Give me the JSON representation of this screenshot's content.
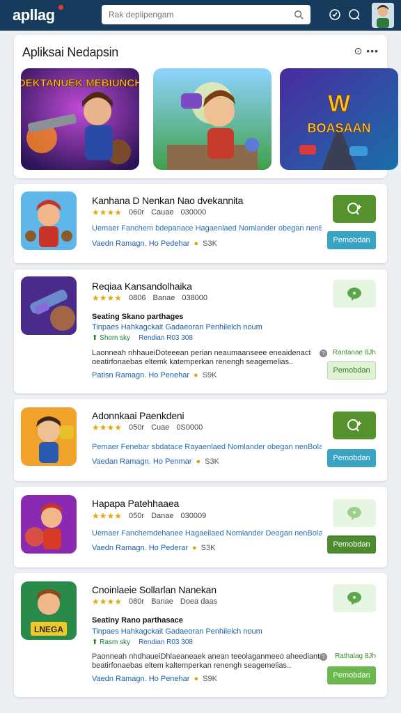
{
  "header": {
    "logo": "apllag",
    "search_placeholder": "Rak deplipengam"
  },
  "featured": {
    "title": "Apliksai Nedapsin",
    "more": "⊙ •••",
    "items": [
      {
        "label": "DEKTANUEK MEBIUNCH"
      },
      {
        "label": ""
      },
      {
        "label": "BOASAAN"
      }
    ]
  },
  "apps": [
    {
      "title": "Kanhana D Nenkan Nao dvekannita",
      "stars": "★★★★",
      "meta1": "060r",
      "meta2": "Cauae",
      "meta3": "030000",
      "desc": "Uemaer Fanchem bdepanace Hagaenlaed Nomlander obegan nenBelaet",
      "foot_left": "Vaedn Ramagn. Ho Pedehar",
      "foot_size": "S3K",
      "action": "Pemobdan"
    },
    {
      "title": "Reqiaa Kansandolhaika",
      "stars": "★★★★",
      "meta1": "0806",
      "meta2": "Banae",
      "meta3": "038000",
      "sub_title": "Seating Skano parthages",
      "sub_desc": "Tinpaes Hahkagckait Gadaeoran Penhilelch noum",
      "tag1": "⬆ Shom sky",
      "tag2": "Rendian R03 308",
      "desc2a": "Laonneah nhhaueiDoteeean perian neaumaanseee eneaidenact",
      "desc2b": "oeatirfonaebas eltemk katemperkan renengh seagemelias..",
      "side_note": "Rantanae 8Jh",
      "foot_left": "Patisn Ramagn. Ho Penehar",
      "foot_size": "S9K",
      "action": "Pemobdan"
    },
    {
      "title": "Adonnkaai Paenkdeni",
      "stars": "★★★★",
      "meta1": "050r",
      "meta2": "Cuae",
      "meta3": "0S0000",
      "desc": "Pemaer Fenebar sbdatace Rayaenlaed Nomlander obegan nenBolaet",
      "foot_left": "Vaedan Ramagn. Ho Penmar",
      "foot_size": "S3K",
      "action": "Pemobdan"
    },
    {
      "title": "Hapapa Patehhaaea",
      "stars": "★★★★",
      "meta1": "050r",
      "meta2": "Danae",
      "meta3": "030009",
      "desc": "Uemaer Fanchemdehanee Hagaeilaed Nomlander Deogan nenBolaet",
      "foot_left": "Vaedn Ramagn. Ho Pederar",
      "foot_size": "S3K",
      "action": "Pemobdan"
    },
    {
      "title": "Cnoinlaeie Sollarlan Nanekan",
      "stars": "★★★★",
      "meta1": "080r",
      "meta2": "Banae",
      "meta3": "Doea daas",
      "sub_title": "Seatiny Rano parthasace",
      "sub_desc": "Tinpaes Hahkagckait Gadaeoran Penhilelch noum",
      "tag1": "⬆ Rasm sky",
      "tag2": "Rendian R03 308",
      "desc2a": "Paonneah nhdhaueiDhlaeaneaek anean teeolaganmeeo aheediantelact",
      "desc2b": "beatirfonaebas eltem kaltemperkan renengh seagemelias..",
      "side_note": "Rathalag 8Jh",
      "foot_left": "Vaedn Ramagn. Ho Penehar",
      "foot_size": "S9K",
      "action": "Pemobdan"
    }
  ],
  "colors": {
    "header_bg": "#173b5c",
    "primary_green": "#55922e",
    "teal_button": "#3aa3c2",
    "link_blue": "#2a6fb0",
    "star_yellow": "#e0a914"
  }
}
